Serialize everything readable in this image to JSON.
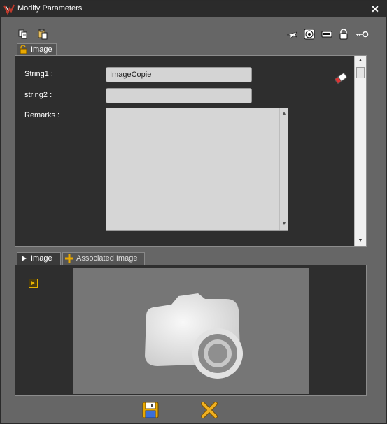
{
  "window": {
    "title": "Modify Parameters",
    "close_glyph": "✕"
  },
  "toolbar_left": [
    {
      "icon": "copy-icon"
    },
    {
      "icon": "paste-icon"
    }
  ],
  "toolbar_right": [
    {
      "icon": "plane-icon"
    },
    {
      "icon": "disc-icon"
    },
    {
      "icon": "badge-icon"
    },
    {
      "icon": "lock-icon"
    },
    {
      "icon": "key-icon"
    }
  ],
  "top_tab": {
    "label": "Image",
    "icon": "unlock-icon"
  },
  "fields": {
    "string1_label": "String1 :",
    "string1_value": "ImageCopie",
    "string2_label": "string2 :",
    "string2_value": "",
    "remarks_label": "Remarks :",
    "remarks_value": ""
  },
  "bottom_tabs": [
    {
      "label": "Image",
      "icon": "play-icon"
    },
    {
      "label": "Associated Image",
      "icon": "plus-icon"
    }
  ],
  "footer": {
    "save_icon": "save-icon",
    "cancel_icon": "cancel-icon"
  },
  "colors": {
    "accent": "#e8a800",
    "titlebar": "#2b2b2b",
    "panel": "#2e2e2e",
    "background": "#666666"
  }
}
